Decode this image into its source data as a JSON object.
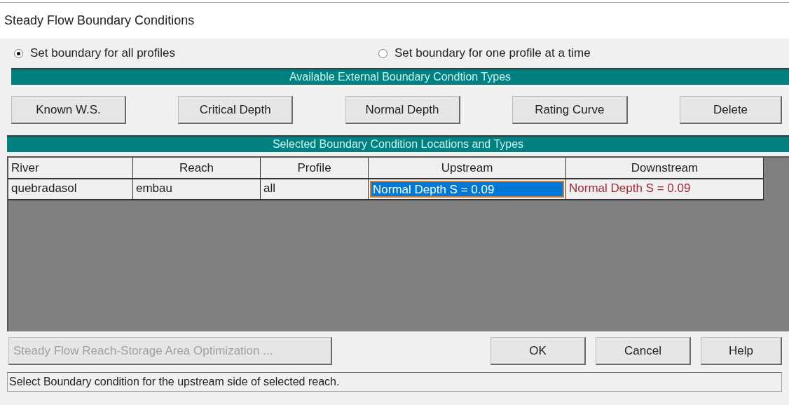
{
  "window": {
    "title": "Steady Flow Boundary Conditions"
  },
  "radios": [
    {
      "label": "Set boundary for all profiles",
      "selected": true
    },
    {
      "label": "Set boundary for one profile at a time",
      "selected": false
    }
  ],
  "types_band": {
    "title": "Available External Boundary Condtion Types"
  },
  "type_buttons": [
    "Known W.S.",
    "Critical Depth",
    "Normal Depth",
    "Rating Curve",
    "Delete"
  ],
  "locations_band": {
    "title": "Selected Boundary Condition Locations and Types"
  },
  "table": {
    "columns": [
      "River",
      "Reach",
      "Profile",
      "Upstream",
      "Downstream"
    ],
    "rows": [
      {
        "cells": [
          {
            "text": "quebradasol",
            "selected": false
          },
          {
            "text": "embau",
            "selected": false
          },
          {
            "text": "all",
            "selected": false
          },
          {
            "text": "Normal Depth S = 0.09",
            "selected": true
          },
          {
            "text": "Normal Depth S = 0.09",
            "selected": false,
            "color": "#a52a32"
          }
        ]
      }
    ]
  },
  "bottom_buttons": [
    {
      "label": "Steady Flow Reach-Storage Area Optimization ...",
      "disabled": true
    },
    {
      "label": "OK",
      "disabled": false
    },
    {
      "label": "Cancel",
      "disabled": false
    },
    {
      "label": "Help",
      "disabled": false
    }
  ],
  "status_bar": "Select Boundary condition for the upstream side of selected reach."
}
